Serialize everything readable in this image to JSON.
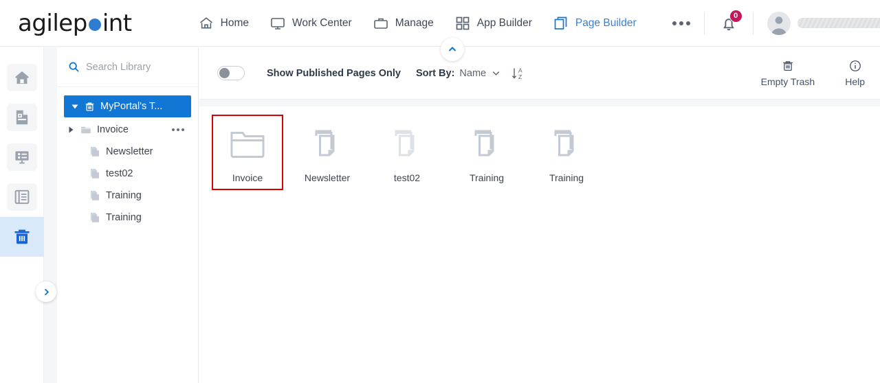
{
  "header": {
    "logo_text": "agilepoint",
    "logo_dot_color": "#2e7dd1",
    "nav": [
      {
        "label": "Home",
        "icon": "home-icon",
        "active": false
      },
      {
        "label": "Work Center",
        "icon": "monitor-icon",
        "active": false
      },
      {
        "label": "Manage",
        "icon": "briefcase-icon",
        "active": false
      },
      {
        "label": "App Builder",
        "icon": "grid-squares-icon",
        "active": false
      },
      {
        "label": "Page Builder",
        "icon": "copy-pages-icon",
        "active": true
      }
    ],
    "overflow_label": "more-options",
    "notification_count": "0",
    "notification_badge_color": "#c2185b",
    "user_name_redacted": true,
    "accent_color": "#1277d4"
  },
  "rail": {
    "items": [
      {
        "name": "home",
        "icon": "home-icon",
        "active": false
      },
      {
        "name": "page",
        "icon": "document-icon",
        "active": false
      },
      {
        "name": "form",
        "icon": "form-tree-icon",
        "active": false
      },
      {
        "name": "layout",
        "icon": "layout-list-icon",
        "active": false
      },
      {
        "name": "trash",
        "icon": "trash-icon",
        "active": true
      }
    ],
    "expand_icon": "chevron-right-icon"
  },
  "collapse_icon": "chevron-up-icon",
  "library": {
    "search": {
      "placeholder": "Search Library",
      "value": "",
      "icon": "search-icon"
    },
    "tree": {
      "root": {
        "label": "MyPortal's T...",
        "icon": "trash-icon",
        "caret": "caret-down-icon",
        "selected": true
      },
      "nodes": [
        {
          "label": "Invoice",
          "icon": "folder-icon",
          "caret": "caret-right-icon",
          "type": "folder",
          "has_menu": true
        },
        {
          "label": "Newsletter",
          "icon": "pages-icon",
          "type": "page"
        },
        {
          "label": "test02",
          "icon": "pages-icon",
          "type": "page"
        },
        {
          "label": "Training",
          "icon": "pages-icon",
          "type": "page"
        },
        {
          "label": "Training",
          "icon": "pages-icon",
          "type": "page"
        }
      ]
    }
  },
  "toolbar": {
    "published_toggle": {
      "label": "Show Published Pages Only",
      "on": false
    },
    "sort_by_label": "Sort By:",
    "sort_by_value": "Name",
    "sort_direction_icon": "sort-az-ascending-icon",
    "empty_trash": {
      "label": "Empty Trash",
      "icon": "trash-icon"
    },
    "help": {
      "label": "Help",
      "icon": "info-icon"
    }
  },
  "items": [
    {
      "label": "Invoice",
      "type": "folder",
      "icon": "folder-icon",
      "highlighted": true,
      "faded": false
    },
    {
      "label": "Newsletter",
      "type": "page",
      "icon": "pages-icon",
      "highlighted": false,
      "faded": false
    },
    {
      "label": "test02",
      "type": "page",
      "icon": "pages-icon",
      "highlighted": false,
      "faded": true
    },
    {
      "label": "Training",
      "type": "page",
      "icon": "pages-icon",
      "highlighted": false,
      "faded": false
    },
    {
      "label": "Training",
      "type": "page",
      "icon": "pages-icon",
      "highlighted": false,
      "faded": false
    }
  ],
  "highlight_color": "#d80000"
}
